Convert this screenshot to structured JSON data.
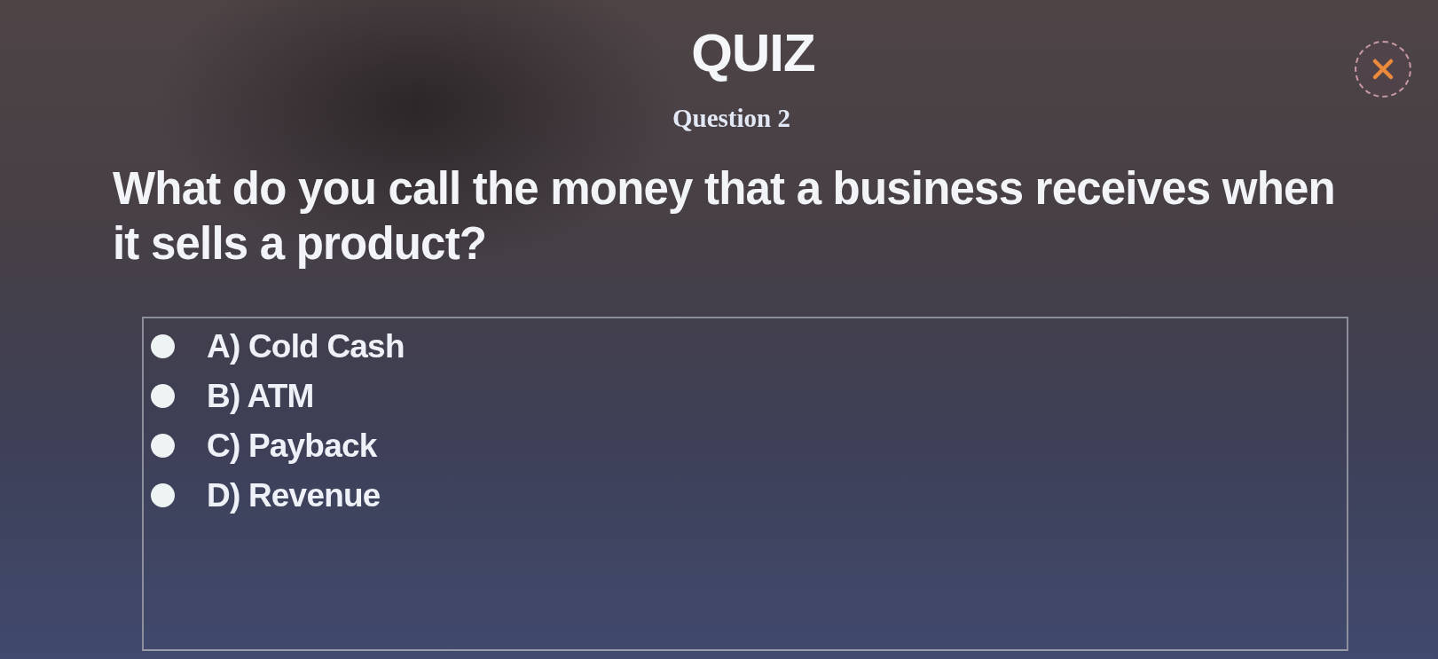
{
  "title": "QUIZ",
  "question_number": "Question 2",
  "question": "What do you call the money that a business receives when it sells a product?",
  "options": [
    {
      "label": "A) Cold Cash",
      "selected": false
    },
    {
      "label": "B) ATM",
      "selected": false
    },
    {
      "label": "C) Payback",
      "selected": false
    },
    {
      "label": "D) Revenue",
      "selected": false
    }
  ]
}
